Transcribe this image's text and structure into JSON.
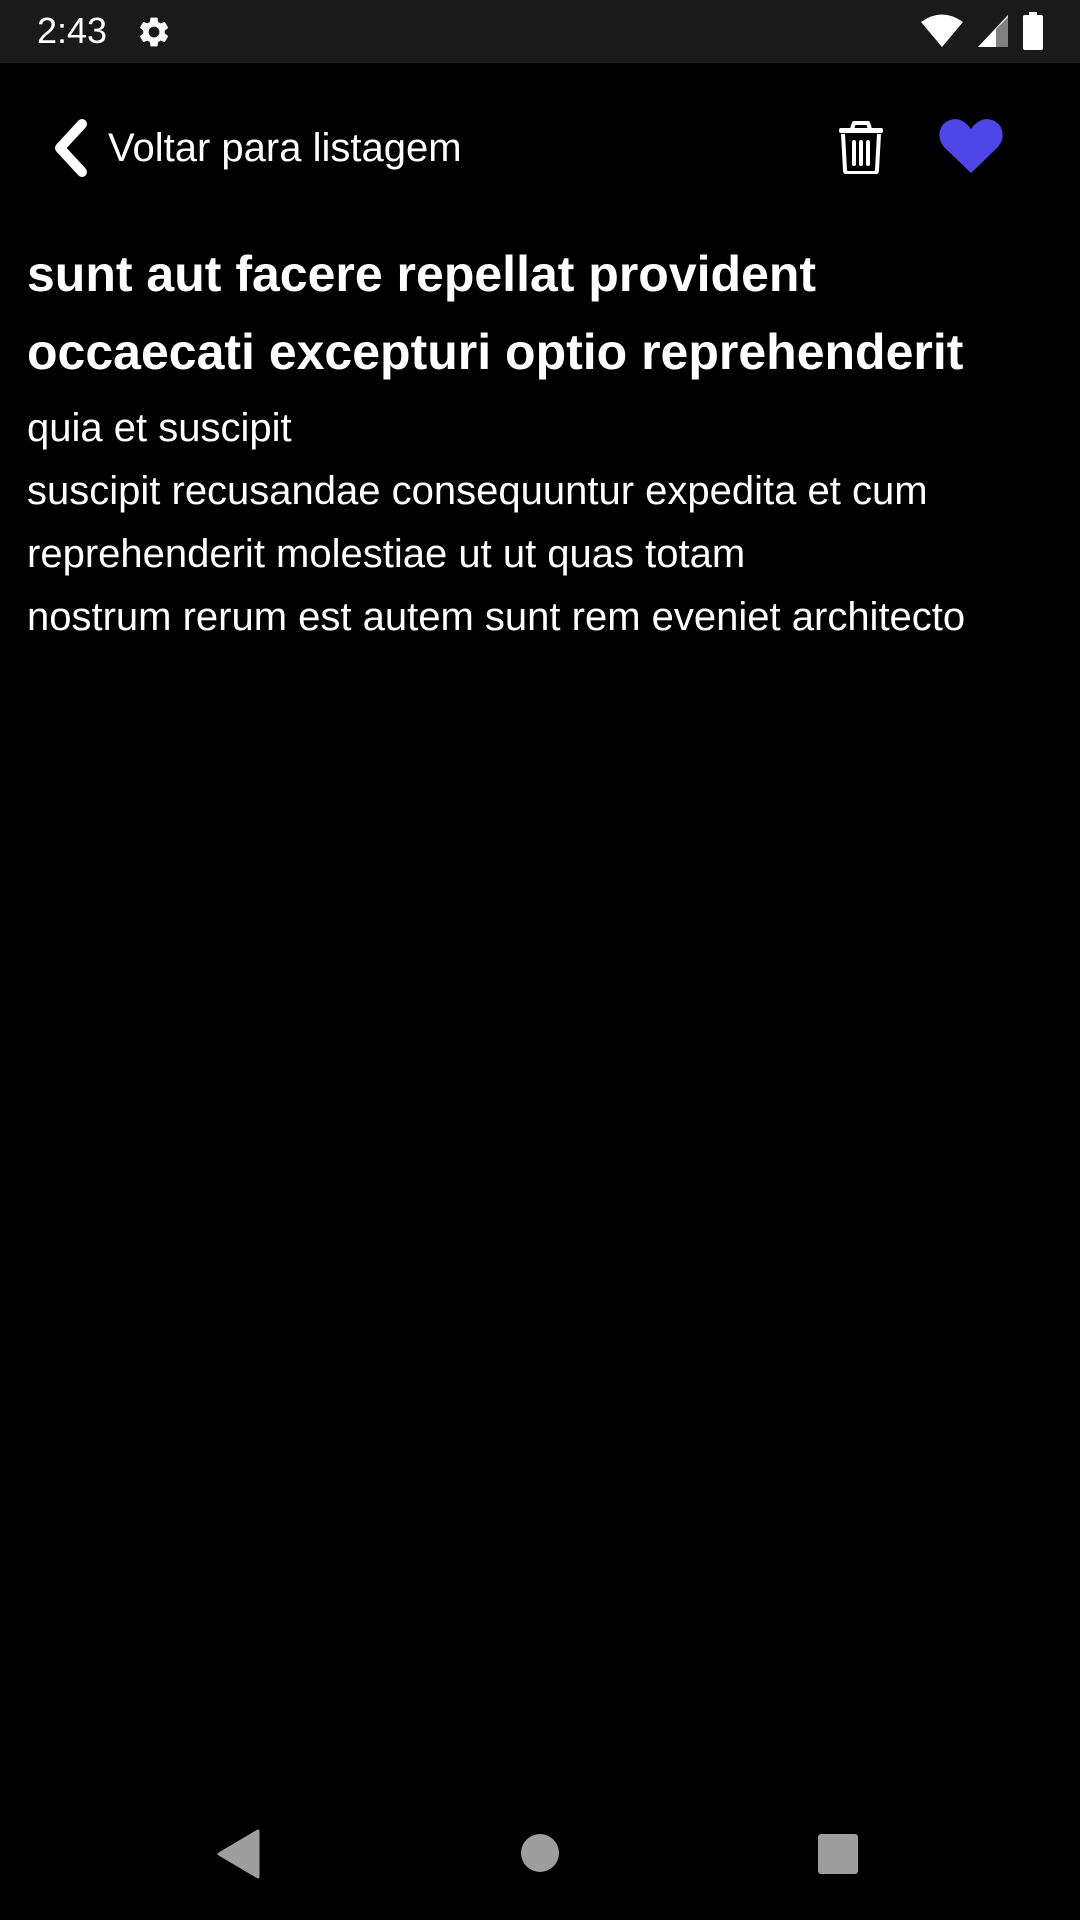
{
  "status_bar": {
    "time": "2:43",
    "icons": [
      "gear-icon",
      "wifi-icon",
      "cell-signal-icon",
      "battery-icon"
    ]
  },
  "header": {
    "back_label": "Voltar para listagem",
    "back_icon": "chevron-left-icon",
    "delete_icon": "trash-icon",
    "favorite_icon": "heart-icon",
    "favorite_color": "#5046e5",
    "favorited": true
  },
  "post": {
    "title": "sunt aut facere repellat provident occaecati excepturi optio reprehenderit",
    "body": "quia et suscipit\nsuscipit recusandae consequuntur expedita et cum reprehenderit molestiae ut ut quas totam\nnostrum rerum est autem sunt rem eveniet architecto"
  },
  "nav_bar": {
    "icons": [
      "nav-back-icon",
      "nav-home-icon",
      "nav-recents-icon"
    ]
  }
}
